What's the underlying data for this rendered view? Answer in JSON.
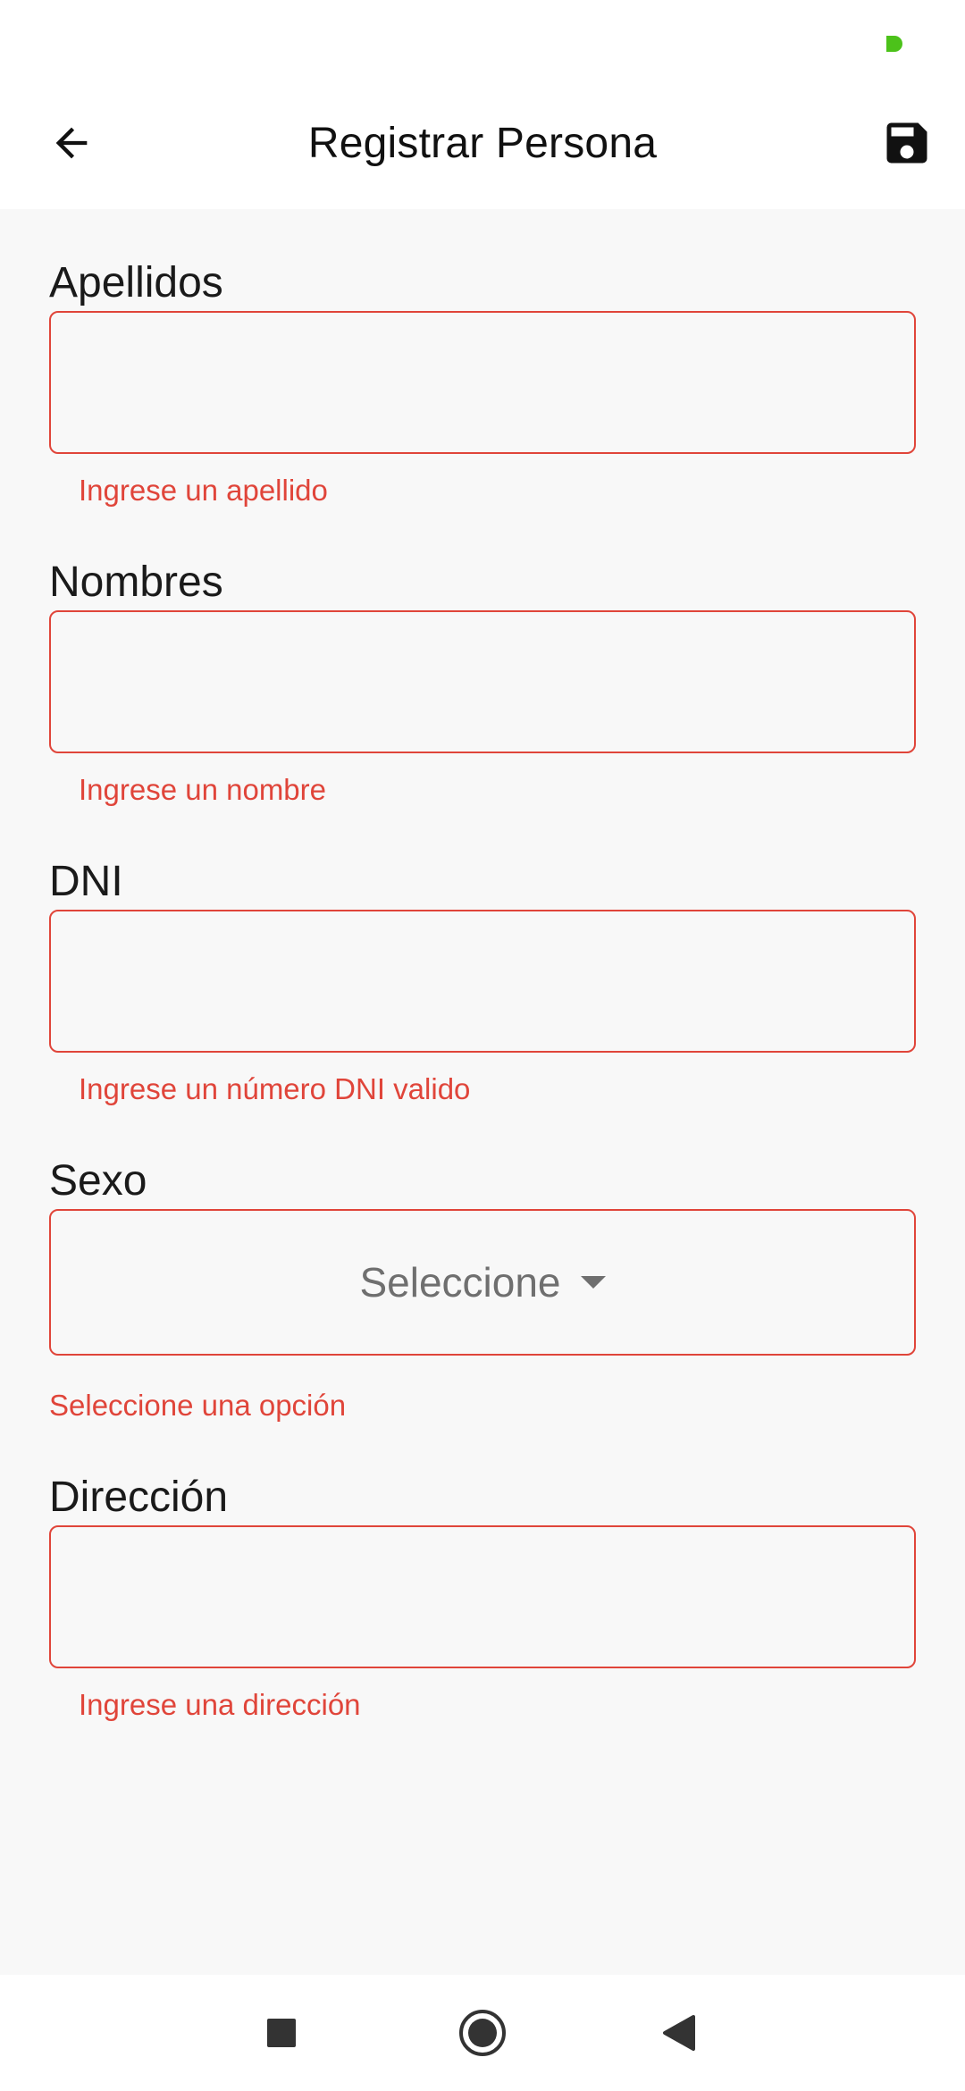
{
  "app_bar": {
    "title": "Registrar Persona",
    "back_icon": "arrow-left-icon",
    "save_icon": "floppy-disk-icon"
  },
  "form": {
    "apellidos": {
      "label": "Apellidos",
      "value": "",
      "error": "Ingrese un apellido"
    },
    "nombres": {
      "label": "Nombres",
      "value": "",
      "error": "Ingrese un nombre"
    },
    "dni": {
      "label": "DNI",
      "value": "",
      "error": "Ingrese un número DNI valido"
    },
    "sexo": {
      "label": "Sexo",
      "selected": "Seleccione",
      "error": "Seleccione una opción"
    },
    "direccion": {
      "label": "Dirección",
      "value": "",
      "error": "Ingrese una dirección"
    }
  },
  "colors": {
    "error": "#e0453a",
    "status_dot": "#4cc21a",
    "background": "#f8f8f8"
  },
  "nav": {
    "recents_icon": "square-icon",
    "home_icon": "circle-home-icon",
    "back_icon": "triangle-back-icon"
  }
}
